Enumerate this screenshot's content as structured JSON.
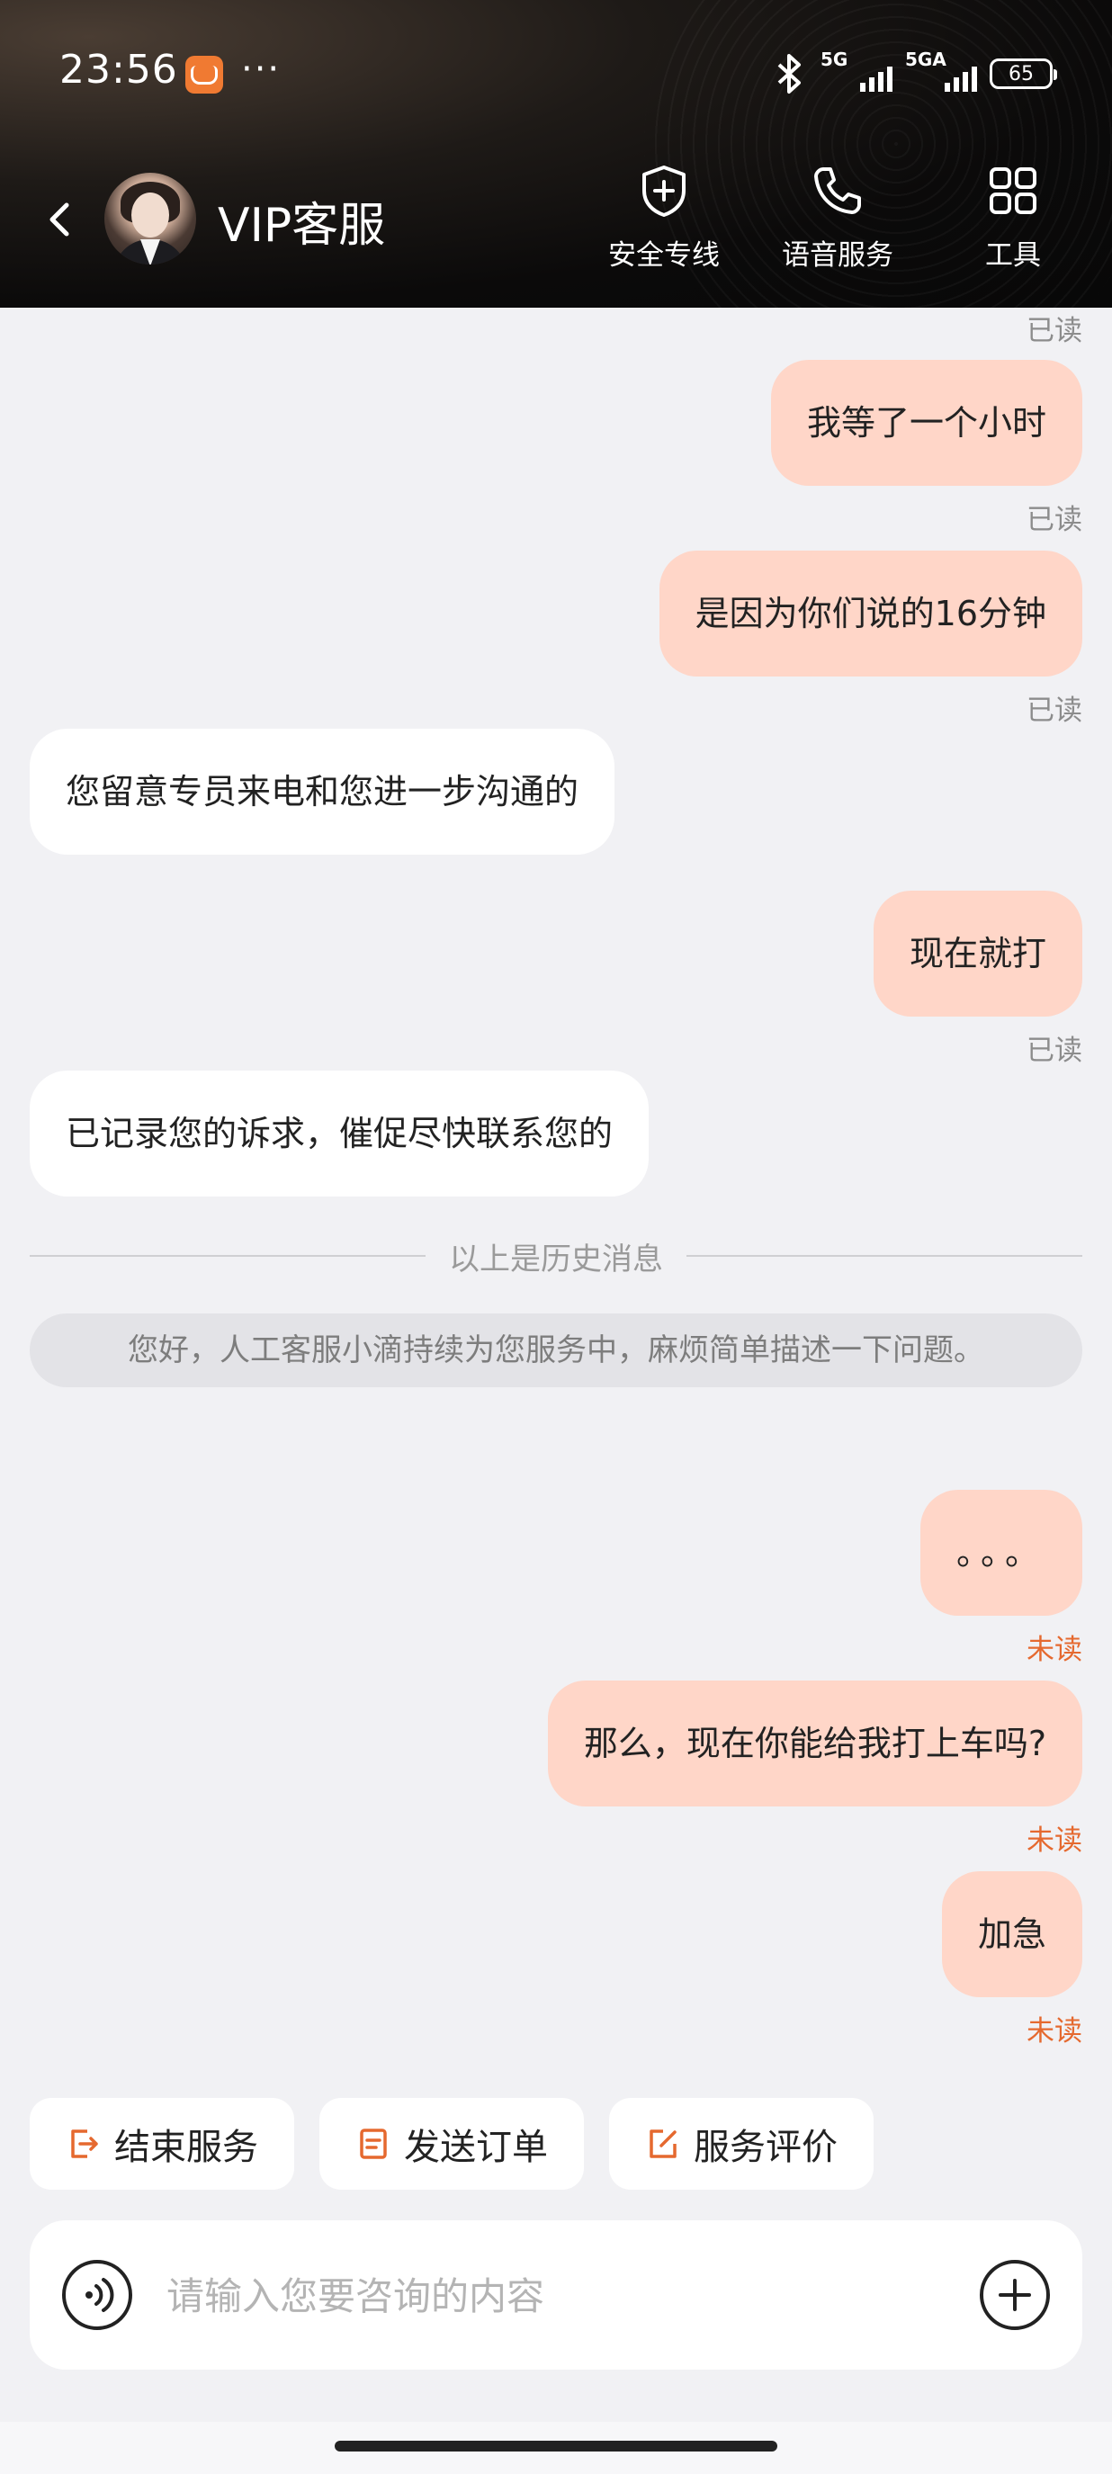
{
  "status_bar": {
    "time": "23:56",
    "more": "···",
    "net1": "5G",
    "net2": "5GA",
    "battery": "65"
  },
  "header": {
    "title": "VIP客服",
    "actions": [
      {
        "label": "安全专线",
        "icon": "shield-plus-icon"
      },
      {
        "label": "语音服务",
        "icon": "phone-icon"
      },
      {
        "label": "工具",
        "icon": "grid-icon"
      }
    ]
  },
  "chat": {
    "top_read": "已读",
    "messages": [
      {
        "side": "me",
        "text": "我等了一个小时",
        "status": "已读"
      },
      {
        "side": "me",
        "text": "是因为你们说的16分钟",
        "status": "已读"
      },
      {
        "side": "other",
        "text": "您留意专员来电和您进一步沟通的"
      },
      {
        "side": "me",
        "text": "现在就打",
        "status": "已读"
      },
      {
        "side": "other",
        "text": "已记录您的诉求，催促尽快联系您的"
      }
    ],
    "history_divider": "以上是历史消息",
    "system_message": "您好，人工客服小滴持续为您服务中，麻烦简单描述一下问题。",
    "new_messages": [
      {
        "side": "me",
        "text": "。。。",
        "status": "未读"
      },
      {
        "side": "me",
        "text": "那么，现在你能给我打上车吗?",
        "status": "未读"
      },
      {
        "side": "me",
        "text": "加急",
        "status": "未读"
      }
    ]
  },
  "quick_actions": [
    {
      "label": "结束服务",
      "icon": "exit-icon"
    },
    {
      "label": "发送订单",
      "icon": "order-icon"
    },
    {
      "label": "服务评价",
      "icon": "edit-icon"
    }
  ],
  "input": {
    "placeholder": "请输入您要咨询的内容",
    "value": ""
  },
  "colors": {
    "accent": "#e5692f",
    "my_bubble": "#ffd6c8",
    "background": "#f1f1f4",
    "header_bg": "#0b0a0a"
  }
}
